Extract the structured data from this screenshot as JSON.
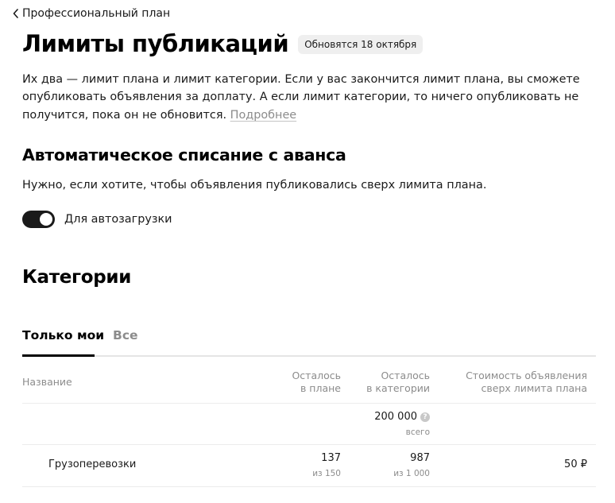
{
  "header": {
    "back_label": "Профессиональный план",
    "title": "Лимиты публикаций",
    "badge": "Обновятся 18 октября"
  },
  "intro": {
    "text": "Их два — лимит плана и лимит категории. Если у вас закончится лимит плана, вы сможете опубликовать объявления за доплату. А если лимит категории, то ничего опубликовать не получится, пока он не обновится.",
    "more_link": "Подробнее"
  },
  "autopay": {
    "title": "Автоматическое списание с аванса",
    "description": "Нужно, если хотите, чтобы объявления публиковались сверх лимита плана.",
    "toggle_label": "Для автозагрузки",
    "toggle_on": true
  },
  "categories": {
    "title": "Категории",
    "tabs": [
      {
        "label": "Только мои",
        "active": true
      },
      {
        "label": "Все",
        "active": false
      }
    ],
    "columns": {
      "name": "Название",
      "plan_line1": "Осталось",
      "plan_line2": "в плане",
      "cat_line1": "Осталось",
      "cat_line2": "в категории",
      "cost_line1": "Стоимость объявления",
      "cost_line2": "сверх лимита плана"
    },
    "total": {
      "value": "200 000",
      "caption": "всего",
      "help_glyph": "?"
    },
    "rows": [
      {
        "name": "Грузоперевозки",
        "plan_left": "137",
        "plan_total": "из 150",
        "cat_left": "987",
        "cat_total": "из 1 000",
        "cost": "50 ₽"
      }
    ]
  },
  "colors": {
    "text": "#1a1a1a",
    "muted": "#8c8c8c",
    "badge_bg": "#efefef",
    "toggle_on": "#1a1a1a",
    "divider": "#ececec"
  },
  "icons": {
    "back": "chevron-left-icon",
    "help": "question-circle-icon"
  }
}
